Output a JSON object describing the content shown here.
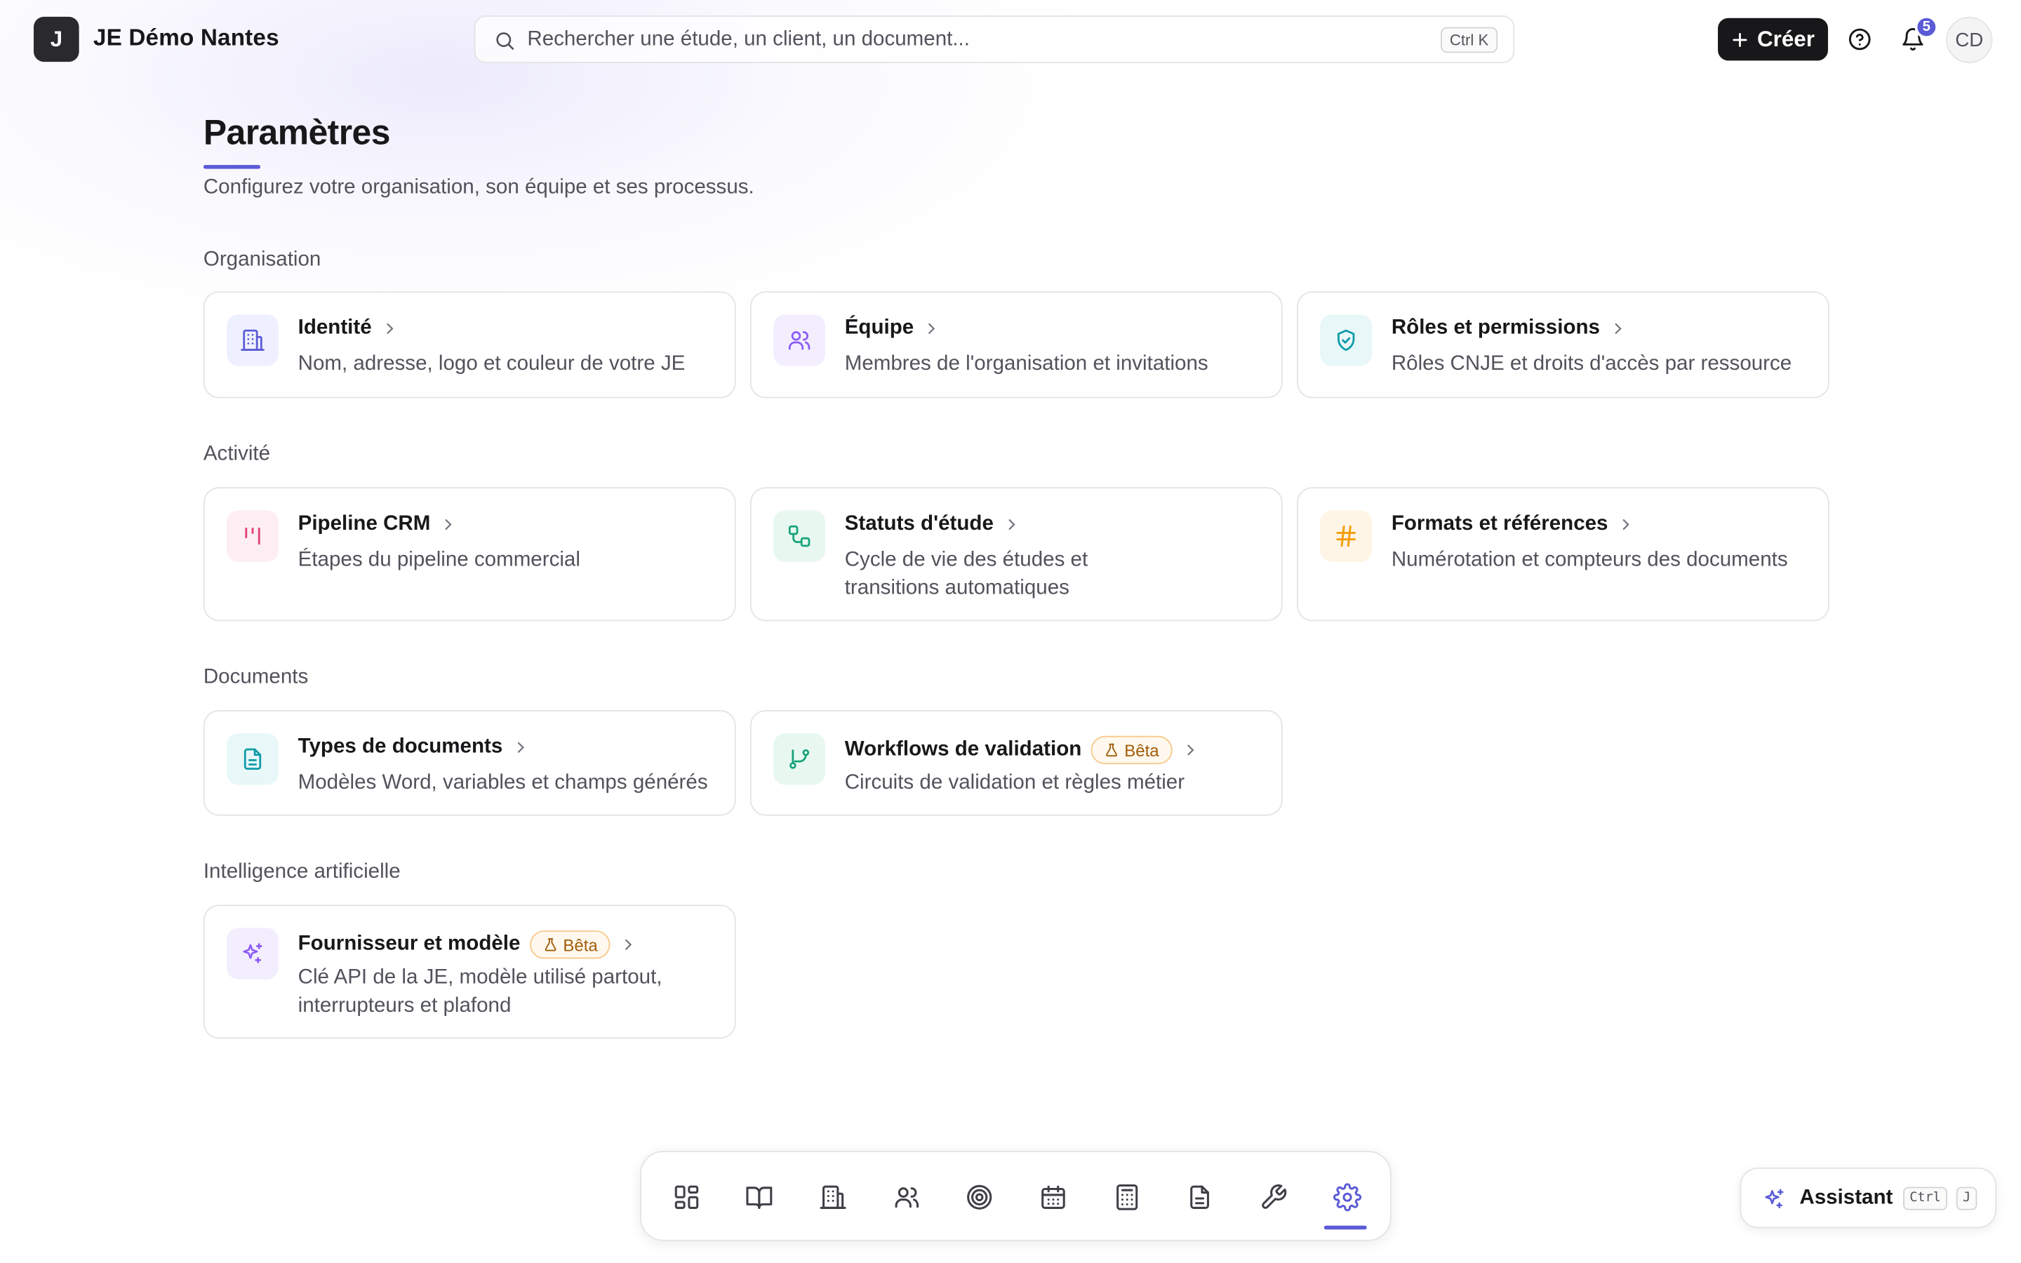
{
  "header": {
    "org_initial": "J",
    "org_name": "JE Démo Nantes",
    "search_placeholder": "Rechercher une étude, un client, un document...",
    "search_shortcut": "Ctrl K",
    "create_label": "Créer",
    "notification_count": "5",
    "user_initials": "CD"
  },
  "page": {
    "title": "Paramètres",
    "subtitle": "Configurez votre organisation, son équipe et ses processus."
  },
  "sections": {
    "organisation": {
      "label": "Organisation",
      "cards": [
        {
          "title": "Identité",
          "description": "Nom, adresse, logo et couleur de votre JE",
          "icon": "building-icon"
        },
        {
          "title": "Équipe",
          "description": "Membres de l'organisation et invitations",
          "icon": "users-icon"
        },
        {
          "title": "Rôles et permissions",
          "description": "Rôles CNJE et droits d'accès par ressource",
          "icon": "shield-check-icon"
        }
      ]
    },
    "activite": {
      "label": "Activité",
      "cards": [
        {
          "title": "Pipeline CRM",
          "description": "Étapes du pipeline commercial",
          "icon": "kanban-icon"
        },
        {
          "title": "Statuts d'étude",
          "description": "Cycle de vie des études et transitions automatiques",
          "icon": "workflow-icon"
        },
        {
          "title": "Formats et références",
          "description": "Numérotation et compteurs des documents",
          "icon": "hash-icon"
        }
      ]
    },
    "documents": {
      "label": "Documents",
      "cards": [
        {
          "title": "Types de documents",
          "description": "Modèles Word, variables et champs générés",
          "icon": "file-text-icon"
        },
        {
          "title": "Workflows de validation",
          "badge": "Bêta",
          "description": "Circuits de validation et règles métier",
          "icon": "git-branch-icon"
        }
      ]
    },
    "ia": {
      "label": "Intelligence artificielle",
      "cards": [
        {
          "title": "Fournisseur et modèle",
          "badge": "Bêta",
          "description": "Clé API de la JE, modèle utilisé partout, interrupteurs et plafond",
          "icon": "sparkles-icon"
        }
      ]
    }
  },
  "dock": {
    "items": [
      "dashboard-icon",
      "book-icon",
      "building-icon",
      "users-icon",
      "target-icon",
      "calendar-icon",
      "calculator-icon",
      "file-icon",
      "wrench-icon",
      "settings-icon"
    ],
    "active": "settings-icon"
  },
  "assistant": {
    "label": "Assistant",
    "key1": "Ctrl",
    "key2": "J"
  },
  "colors": {
    "accent": "#5b5bd6",
    "beta_border": "#f8c98a",
    "beta_text": "#a15c07"
  }
}
